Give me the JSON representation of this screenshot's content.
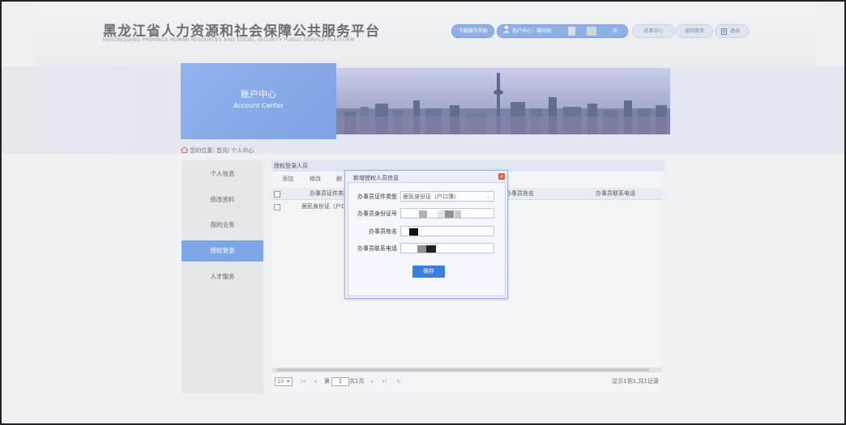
{
  "header": {
    "title": "黑龙江省人力资源和社会保障公共服务平台",
    "subtitle": "HEILONGJIANG PROVINCE HUMAN RESOURCES AND SOCIAL SECURITY PUBLIC SERVICE PLATFORM",
    "download_label": "下载操作手册",
    "user_label": "用户中心：",
    "user_name": "福州润",
    "user_suffix": "司",
    "business_center_label": "办事中心",
    "home_label": "返回首页",
    "logout_label": "退出"
  },
  "banner": {
    "title_cn": "账户中心",
    "title_en": "Account Center"
  },
  "breadcrumb": {
    "prefix": "您的位置: ",
    "path": "首页/ 个人中心"
  },
  "sidebar": {
    "items": [
      {
        "label": "个人信息"
      },
      {
        "label": "修改资料"
      },
      {
        "label": "我的业务"
      },
      {
        "label": "授权登录"
      },
      {
        "label": "人才服务"
      }
    ]
  },
  "panel": {
    "title": "授权登录人员",
    "toolbar": {
      "add": "添加",
      "edit": "修改",
      "delete": "删"
    },
    "columns": [
      "办事员证件类",
      "办事员姓名",
      "办事员联系电话"
    ],
    "rows": [
      {
        "id_type": "居民身份证（户口"
      }
    ]
  },
  "pager": {
    "page_size": "10",
    "page_prefix": "第",
    "page_value": "1",
    "page_total": "共1页",
    "summary": "显示1到1,共1记录"
  },
  "dialog": {
    "title": "新增授权人员信息",
    "close_glyph": "×",
    "fields": {
      "id_type_label": "办事员证件类型",
      "id_type_value": "居民身份证（户口簿）",
      "id_number_label": "办事员身份证号",
      "name_label": "办事员姓名",
      "phone_label": "办事员联系电话"
    },
    "save_label": "保存"
  },
  "icons": {
    "home": "home-icon",
    "user": "user-icon",
    "logout": "logout-icon",
    "dropdown": "chevron-down-icon"
  },
  "colors": {
    "accent": "#7ea6e6",
    "button": "#3d7ddb",
    "close": "#e25c3b"
  }
}
